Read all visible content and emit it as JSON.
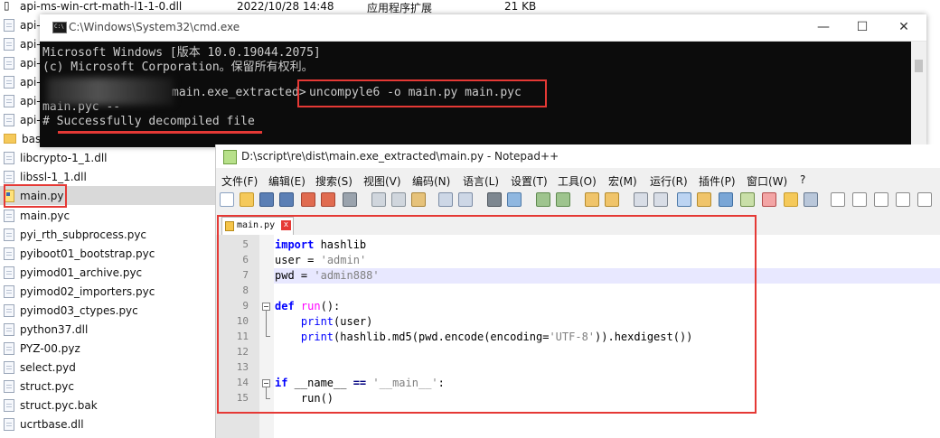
{
  "explorer": {
    "top_row": {
      "name": "api-ms-win-crt-math-l1-1-0.dll",
      "date": "2022/10/28 14:48",
      "type": "应用程序扩展",
      "size": "21 KB"
    },
    "partial_rows": [
      "api-",
      "api-",
      "api-",
      "api-",
      "api-",
      "api-"
    ],
    "base_row": "base",
    "files": [
      {
        "name": "libcrypto-1_1.dll",
        "kind": "file"
      },
      {
        "name": "libssl-1_1.dll",
        "kind": "file"
      },
      {
        "name": "main.py",
        "kind": "py"
      },
      {
        "name": "main.pyc",
        "kind": "file"
      },
      {
        "name": "pyi_rth_subprocess.pyc",
        "kind": "file"
      },
      {
        "name": "pyiboot01_bootstrap.pyc",
        "kind": "file"
      },
      {
        "name": "pyimod01_archive.pyc",
        "kind": "file"
      },
      {
        "name": "pyimod02_importers.pyc",
        "kind": "file"
      },
      {
        "name": "pyimod03_ctypes.pyc",
        "kind": "file"
      },
      {
        "name": "python37.dll",
        "kind": "file"
      },
      {
        "name": "PYZ-00.pyz",
        "kind": "file"
      },
      {
        "name": "select.pyd",
        "kind": "file"
      },
      {
        "name": "struct.pyc",
        "kind": "file"
      },
      {
        "name": "struct.pyc.bak",
        "kind": "file"
      },
      {
        "name": "ucrtbase.dll",
        "kind": "file"
      }
    ]
  },
  "cmd": {
    "title": "C:\\Windows\\System32\\cmd.exe",
    "minimize": "—",
    "maximize": "☐",
    "close": "✕",
    "lines": [
      "Microsoft Windows [版本 10.0.19044.2075]",
      "(c) Microsoft Corporation。保留所有权利。"
    ],
    "prompt_suffix": "main.exe_extracted>",
    "command": "uncompyle6 -o main.py main.pyc",
    "output_1": "main.pyc --",
    "output_2": "# Successfully decompiled file"
  },
  "notepad": {
    "title": "D:\\script\\re\\dist\\main.exe_extracted\\main.py - Notepad++",
    "menu": [
      "文件(F)",
      "编辑(E)",
      "搜索(S)",
      "视图(V)",
      "编码(N)",
      "语言(L)",
      "设置(T)",
      "工具(O)",
      "宏(M)",
      "运行(R)",
      "插件(P)",
      "窗口(W)",
      "?"
    ],
    "tab_label": "main.py",
    "tab_close": "x",
    "line_numbers": [
      "5",
      "6",
      "7",
      "8",
      "9",
      "10",
      "11",
      "12",
      "13",
      "14",
      "15"
    ],
    "code": {
      "l5_kw": "import",
      "l5_rest": " hashlib",
      "l6_var": "user",
      "l6_eq": " = ",
      "l6_str": "'admin'",
      "l7_var": "pwd",
      "l7_eq": " = ",
      "l7_str": "'admin888'",
      "l9_kw": "def",
      "l9_fn": " run",
      "l9_rest": "():",
      "l10_indent": "    ",
      "l10_bi": "print",
      "l10_rest": "(user)",
      "l11_indent": "    ",
      "l11_bi": "print",
      "l11_a": "(hashlib.md5(pwd.encode(encoding=",
      "l11_str": "'UTF-8'",
      "l11_b": ")).hexdigest())",
      "l14_kw": "if",
      "l14_a": " __name__ ",
      "l14_op": "==",
      "l14_sp": " ",
      "l14_str": "'__main__'",
      "l14_b": ":",
      "l15_indent": "    ",
      "l15_rest": "run()"
    }
  },
  "colors": {
    "highlight_box": "#e53935",
    "keyword": "#0000ff",
    "string": "#808080",
    "function": "#ff00ff"
  }
}
